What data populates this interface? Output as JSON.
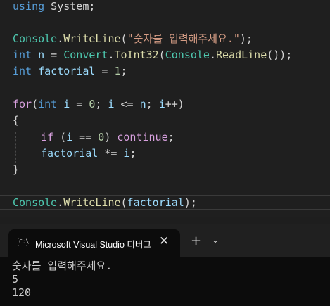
{
  "editor": {
    "line1": {
      "kw": "using",
      "rest": " System;"
    },
    "line2": {
      "cls": "Console",
      "dot": ".",
      "mth": "WriteLine",
      "open": "(",
      "str": "\"숫자를 입력해주세요.\"",
      "close": ");"
    },
    "line3": {
      "kw": "int",
      "sp": " ",
      "var": "n",
      "eq": " = ",
      "cls": "Convert",
      "dot": ".",
      "mth": "ToInt32",
      "open": "(",
      "cls2": "Console",
      "dot2": ".",
      "mth2": "ReadLine",
      "close": "());"
    },
    "line4": {
      "kw": "int",
      "sp": " ",
      "var": "factorial",
      "eq": " = ",
      "num": "1",
      "end": ";"
    },
    "line5": {
      "ctl": "for",
      "open": "(",
      "kw": "int",
      "sp": " ",
      "var": "i",
      "eq": " = ",
      "num": "0",
      "semi": "; ",
      "var2": "i",
      "le": " <= ",
      "var3": "n",
      "semi2": "; ",
      "var4": "i",
      "inc": "++)"
    },
    "line6": {
      "brace": "{"
    },
    "line7": {
      "ctl": "if",
      "open": " (",
      "var": "i",
      "eq": " == ",
      "num": "0",
      "close": ") ",
      "ctl2": "continue",
      "end": ";"
    },
    "line8": {
      "var": "factorial",
      "op": " *= ",
      "var2": "i",
      "end": ";"
    },
    "line9": {
      "brace": "}"
    },
    "line10": {
      "cls": "Console",
      "dot": ".",
      "mth": "WriteLine",
      "open": "(",
      "var": "factorial",
      "close": ");"
    }
  },
  "terminal": {
    "tab_icon": "C:\\",
    "tab_title": "Microsoft Visual Studio 디버그",
    "close_glyph": "✕",
    "new_tab_glyph": "+",
    "dropdown_glyph": "⌄",
    "output": [
      "숫자를 입력해주세요.",
      "5",
      "120"
    ]
  },
  "colors": {
    "keyword": "#569cd6",
    "class": "#4ec9b0",
    "method": "#dcdcaa",
    "string": "#d69d85",
    "number": "#b5cea8",
    "variable": "#9cdcfe",
    "control": "#d8a0df"
  }
}
